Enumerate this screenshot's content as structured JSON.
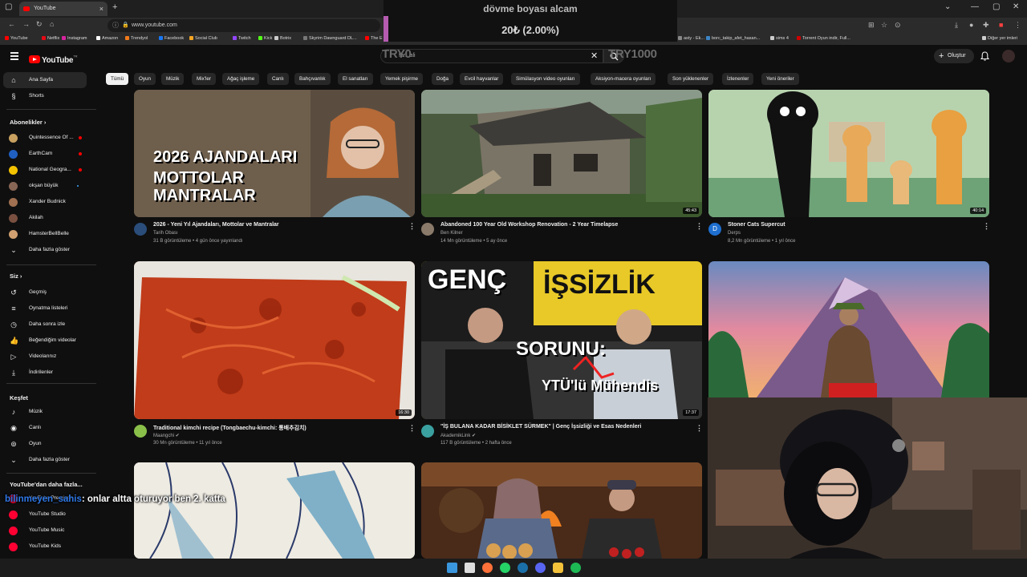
{
  "browser": {
    "tab_title": "YouTube",
    "url": "www.youtube.com",
    "bookmarks": [
      {
        "label": "YouTube",
        "color": "#ff0000"
      },
      {
        "label": "Netflix",
        "color": "#e50914"
      },
      {
        "label": "Instagram",
        "color": "#d6249f"
      },
      {
        "label": "Amazon",
        "color": "#ffffff"
      },
      {
        "label": "Trendyol",
        "color": "#f27a1a"
      },
      {
        "label": "Facebook",
        "color": "#1877f2"
      },
      {
        "label": "Social Club",
        "color": "#f5a623"
      },
      {
        "label": "Twitch",
        "color": "#9146ff"
      },
      {
        "label": "Kick",
        "color": "#53fc18"
      },
      {
        "label": "Botrix",
        "color": "#cccccc"
      },
      {
        "label": "Skyrim Dawnguard DL...",
        "color": "#777777"
      },
      {
        "label": "The E",
        "color": "#ff0000"
      }
    ],
    "bookmarks_right": [
      {
        "label": "asty - Ek...",
        "color": "#888888"
      },
      {
        "label": "borc_takip_afet_hasan...",
        "color": "#3d85c6"
      },
      {
        "label": "Torrent Oyun indir, Full...",
        "color": "#cc0000"
      },
      {
        "label": "sims 4",
        "color": "#cccccc"
      }
    ],
    "other_bookmarks": "Diğer yer imleri"
  },
  "overlay": {
    "donation_title": "dövme boyası alcam",
    "donation_value": "20₺ (2.00%)",
    "try_left": "TRY0",
    "try_right": "TRY1000"
  },
  "header": {
    "logo": "YouTube",
    "logo_region": "TR",
    "search_value": "farl..ali",
    "create_label": "Oluştur"
  },
  "sidebar": {
    "main": [
      {
        "label": "Ana Sayfa",
        "icon": "home-icon",
        "glyph": "⌂",
        "active": true
      },
      {
        "label": "Shorts",
        "icon": "shorts-icon",
        "glyph": "§"
      }
    ],
    "subscriptions_title": "Abonelikler",
    "subscriptions": [
      {
        "label": "Quintessence Of ...",
        "color": "#c8a060",
        "badge": "live"
      },
      {
        "label": "EarthCam",
        "color": "#2060c0",
        "badge": "live"
      },
      {
        "label": "National Geogra...",
        "color": "#f4c300",
        "badge": "live"
      },
      {
        "label": "okşan büyük",
        "color": "#886655",
        "badge": "dot"
      },
      {
        "label": "Xander Budnick",
        "color": "#a07050"
      },
      {
        "label": "Akilah",
        "color": "#7a5040"
      },
      {
        "label": "HamsterBellBelle",
        "color": "#d0a070"
      }
    ],
    "more_subs": "Daha fazla göster",
    "you_title": "Siz",
    "you": [
      {
        "label": "Geçmiş",
        "icon": "history-icon",
        "glyph": "↺"
      },
      {
        "label": "Oynatma listeleri",
        "icon": "playlist-icon",
        "glyph": "≡"
      },
      {
        "label": "Daha sonra izle",
        "icon": "clock-icon",
        "glyph": "◷"
      },
      {
        "label": "Beğendiğim videolar",
        "icon": "like-icon",
        "glyph": "👍"
      },
      {
        "label": "Videolarınız",
        "icon": "video-icon",
        "glyph": "▷"
      },
      {
        "label": "İndirilenler",
        "icon": "download-icon",
        "glyph": "⤓"
      }
    ],
    "explore_title": "Keşfet",
    "explore": [
      {
        "label": "Müzik",
        "icon": "music-icon",
        "glyph": "♪"
      },
      {
        "label": "Canlı",
        "icon": "live-icon",
        "glyph": "◉"
      },
      {
        "label": "Oyun",
        "icon": "gamepad-icon",
        "glyph": "⊚"
      }
    ],
    "more_explore": "Daha fazla göster",
    "more_from_title": "YouTube'dan daha fazla...",
    "more_from": [
      {
        "label": "YouTube Premium"
      },
      {
        "label": "YouTube Studio"
      },
      {
        "label": "YouTube Music"
      },
      {
        "label": "YouTube Kids"
      }
    ]
  },
  "chips": [
    "Tümü",
    "Oyun",
    "Müzik",
    "Mix'ler",
    "Ağaç işleme",
    "Canlı",
    "Bahçıvanlık",
    "El sanatları",
    "Yemek pişirme",
    "Doğa",
    "Evcil hayvanlar",
    "Simülasyon video oyunları",
    "Aksiyon-macera oyunları",
    "Son yüklenenler",
    "İzlenenler",
    "Yeni öneriler"
  ],
  "videos": [
    {
      "title": "2026 - Yeni Yıl Ajandaları, Mottolar ve Mantralar",
      "channel": "Tarih Obası",
      "meta": "31 B görüntüleme • 4 gün önce yayınlandı",
      "duration": "3:28:19",
      "thumb_text": [
        "2026 AJANDALARI",
        "MOTTOLAR",
        "MANTRALAR"
      ],
      "thumb_color": "#6b5b4a",
      "avatar_color": "#2a4d7a"
    },
    {
      "title": "Abandoned 100 Year Old Workshop Renovation - 2 Year Timelapse",
      "channel": "Ben Kilner",
      "meta": "14 Mn görüntüleme • 5 ay önce",
      "duration": "45:43",
      "thumb_color": "#4e5a44",
      "avatar_color": "#8a7a6a"
    },
    {
      "title": "Stoner Cats Supercut",
      "channel": "Derps",
      "meta": "8,2 Mn görüntüleme • 1 yıl önce",
      "duration": "40:14",
      "thumb_color": "#a9c9a4",
      "avatar_color": "#1e6fd0",
      "avatar_letter": "D"
    },
    {
      "title": "Traditional kimchi recipe (Tongbaechu-kimchi: 통배추김치)",
      "channel": "Maangchi",
      "meta": "30 Mn görüntüleme • 11 yıl önce",
      "duration": "16:30",
      "thumb_color": "#c2451e",
      "avatar_color": "#8ac04a",
      "verified": true
    },
    {
      "title": "\"İŞ BULANA KADAR BİSİKLET SÜRMEK\" | Genç İşsizliği ve Esas Nedenleri",
      "channel": "AkademikLink",
      "meta": "117 B görüntüleme • 2 hafta önce",
      "duration": "17:37",
      "thumb_text": [
        "GENÇ",
        "İŞSİZLİK",
        "SORUNU:",
        "YTÜ'lü Mühendis"
      ],
      "thumb_color": "#e8c928",
      "avatar_color": "#3aa0a0",
      "verified": true
    },
    {
      "title": "",
      "channel": "",
      "meta": "",
      "duration": "",
      "thumb_color": "#c96a8a"
    },
    {
      "title": "",
      "channel": "",
      "meta": "",
      "duration": "",
      "thumb_color": "#e8e4d8"
    },
    {
      "title": "",
      "channel": "",
      "meta": "",
      "duration": "",
      "thumb_color": "#6b3a20"
    }
  ],
  "chat": {
    "user": "bilinmeyen_sahis",
    "message": ": onlar altta oturuyor ben 2. katta"
  },
  "taskbar": [
    {
      "name": "start-icon",
      "color": "#3a96dd"
    },
    {
      "name": "search-icon",
      "color": "#dddddd"
    },
    {
      "name": "firefox-icon",
      "color": "#ff7139"
    },
    {
      "name": "whatsapp-icon",
      "color": "#25d366"
    },
    {
      "name": "steam-icon",
      "color": "#1b6fa8"
    },
    {
      "name": "discord-icon",
      "color": "#5865f2"
    },
    {
      "name": "folder-icon",
      "color": "#f3c13a"
    },
    {
      "name": "spotify-icon",
      "color": "#1db954"
    }
  ]
}
